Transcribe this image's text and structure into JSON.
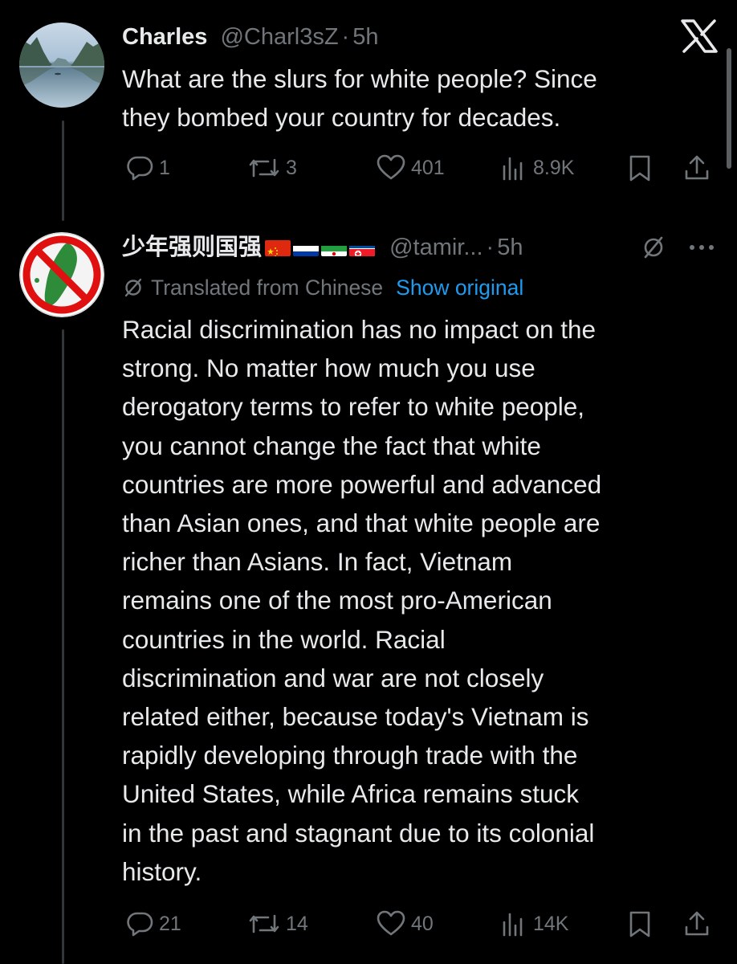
{
  "tweets": [
    {
      "name": "Charles",
      "handle": "@Charl3sZ",
      "dot": "·",
      "time": "5h",
      "lines": [
        "What are the slurs for white people? Since",
        "they bombed your country for decades."
      ],
      "replies": "1",
      "reposts": "3",
      "likes": "401",
      "views": "8.9K"
    },
    {
      "name": "少年强则国强",
      "handle": "@tamir...",
      "dot": "·",
      "time": "5h",
      "translated_label": "Translated from Chinese",
      "show_original": "Show original",
      "lines": [
        "Racial discrimination has no impact on the",
        "strong. No matter how much you use",
        "derogatory terms to refer to white people,",
        "you cannot change the fact that white",
        "countries are more powerful and advanced",
        "than Asian ones, and that white people are",
        "richer than Asians. In fact, Vietnam",
        "remains one of the most pro-American",
        "countries in the world. Racial",
        "discrimination and war are not closely",
        "related either, because today's Vietnam is",
        "rapidly developing through trade with the",
        "United States, while Africa remains stuck",
        "in the past and stagnant due to its colonial",
        "history."
      ],
      "replies": "21",
      "reposts": "14",
      "likes": "40",
      "views": "14K"
    }
  ],
  "icons": {
    "logo": "x-logo",
    "reply": "speech-bubble",
    "repost": "two-arrows-loop",
    "like": "heart",
    "views": "bar-chart",
    "bookmark": "bookmark",
    "share": "arrow-up-tray",
    "more": "three-dots",
    "translate": "slashed-circle",
    "flags": [
      "flag-china",
      "flag-russia",
      "flag-iran",
      "flag-north-korea"
    ]
  },
  "colors": {
    "background": "#000000",
    "text": "#e7e9ea",
    "muted": "#71767b",
    "link": "#1d9bf0",
    "thread_line": "#333639"
  }
}
